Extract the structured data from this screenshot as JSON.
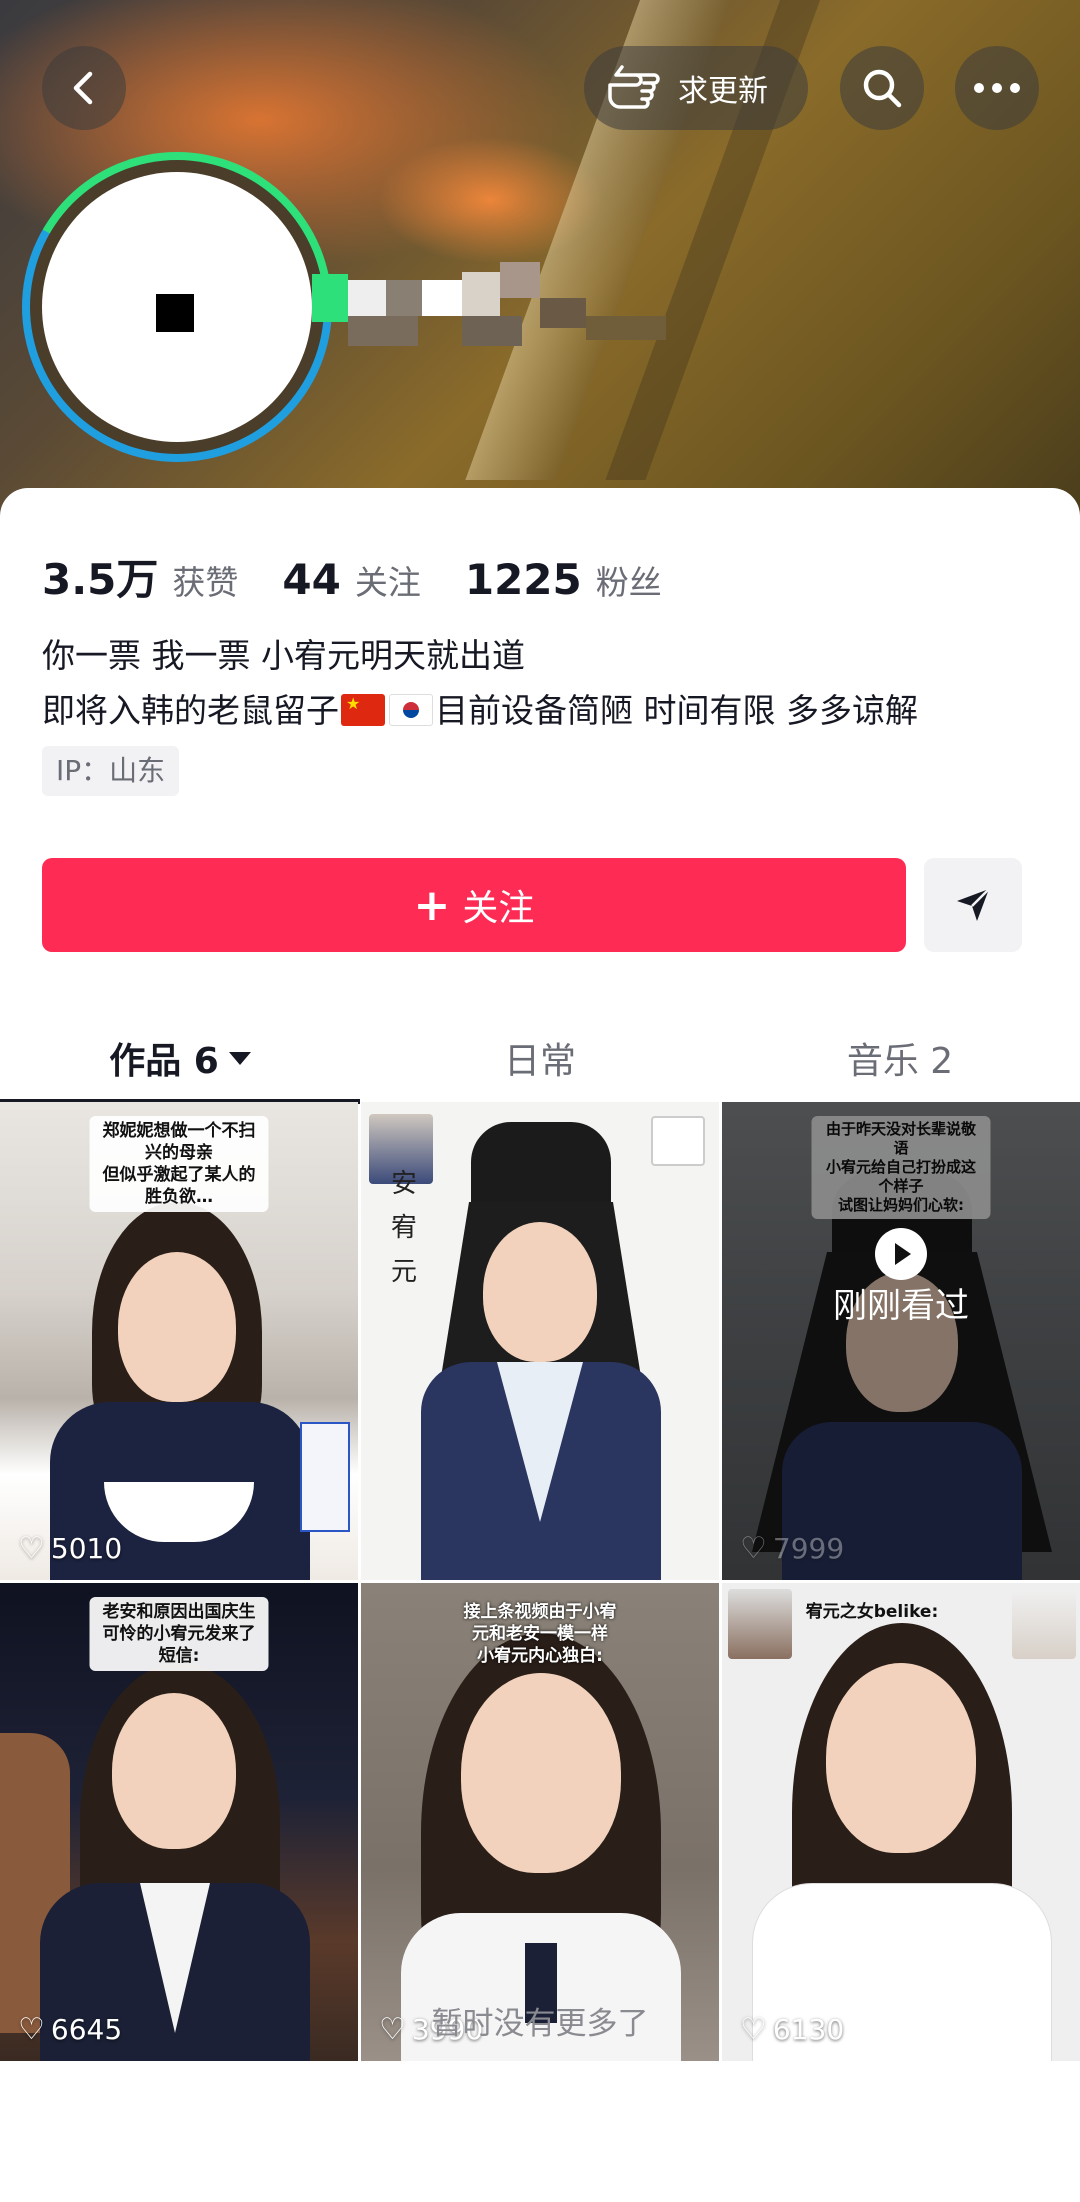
{
  "header": {
    "back_icon": "chevron-left-icon",
    "update_label": "求更新",
    "update_icon": "pointing-hand-icon",
    "search_icon": "search-icon",
    "more_icon": "more-dots-icon"
  },
  "profile": {
    "stats": [
      {
        "value": "3.5万",
        "label": "获赞"
      },
      {
        "value": "44",
        "label": "关注"
      },
      {
        "value": "1225",
        "label": "粉丝"
      }
    ],
    "bio_line1": "你一票 我一票 小宥元明天就出道",
    "bio_line2_prefix": "即将入韩的老鼠留子",
    "bio_line2_suffix": "目前设备简陋 时间有限 多多谅解",
    "ip": "IP：山东"
  },
  "actions": {
    "follow_plus": "+",
    "follow_label": "关注",
    "share_icon": "paper-plane-icon"
  },
  "tabs": [
    {
      "label": "作品 6",
      "active": true
    },
    {
      "label": "日常",
      "active": false
    },
    {
      "label": "音乐 2",
      "active": false
    }
  ],
  "videos": [
    {
      "caption": "郑妮妮想做一个不扫兴的母亲\n但似乎激起了某人的胜负欲…",
      "likes": "5010"
    },
    {
      "caption": "安\n宥\n元",
      "likes": ""
    },
    {
      "caption": "由于昨天没对长辈说敬语\n小宥元给自己打扮成这个样子\n试图让妈妈们心软:",
      "likes": "7999",
      "watched_label": "刚刚看过"
    },
    {
      "caption": "老安和原因出国庆生\n可怜的小宥元发来了短信:",
      "likes": "6645"
    },
    {
      "caption": "接上条视频由于小宥元和老安一模一样\n小宥元内心独白:",
      "likes": "3990"
    },
    {
      "caption": "宥元之女belike:",
      "likes": "6130"
    }
  ],
  "footer": {
    "end_text": "暂时没有更多了"
  },
  "colors": {
    "accent": "#fe2c55",
    "text_primary": "#161823",
    "text_secondary": "#6b6d76"
  }
}
